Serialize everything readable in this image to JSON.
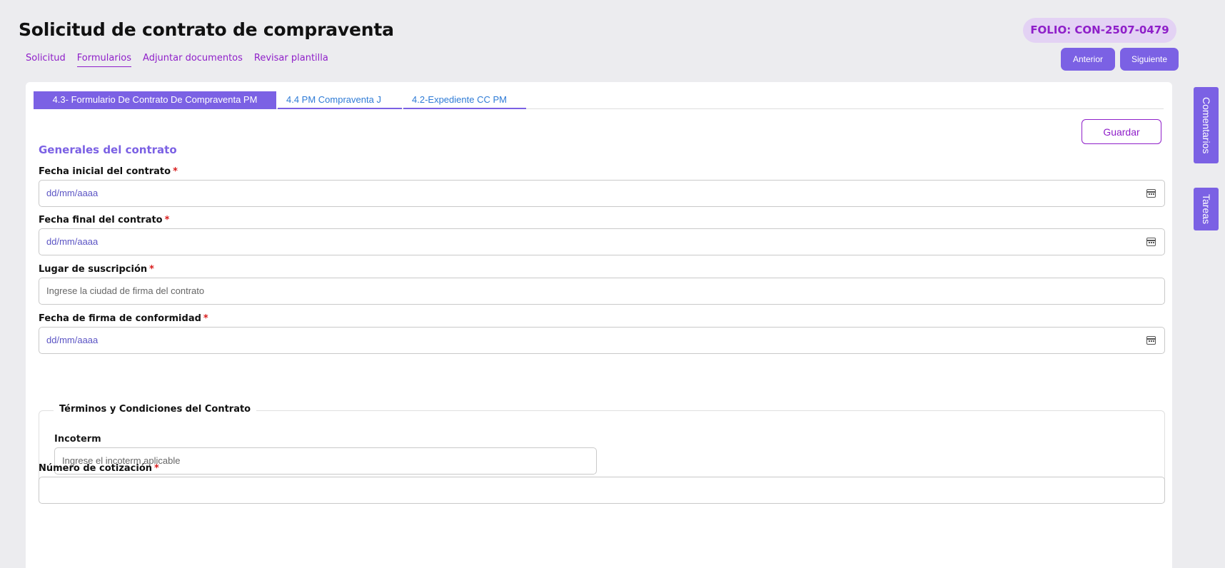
{
  "header": {
    "title": "Solicitud de contrato de compraventa",
    "folio": "FOLIO: CON-2507-0479",
    "prev_label": "Anterior",
    "next_label": "Siguiente"
  },
  "nav": [
    {
      "label": "Solicitud",
      "active": false
    },
    {
      "label": "Formularios",
      "active": true
    },
    {
      "label": "Adjuntar documentos",
      "active": false
    },
    {
      "label": "Revisar plantilla",
      "active": false
    }
  ],
  "tabs": [
    {
      "label": "4.3- Formulario De Contrato De Compraventa PM",
      "active": true
    },
    {
      "label": "4.4 PM Compraventa J",
      "active": false
    },
    {
      "label": "4.2-Expediente CC PM",
      "active": false
    }
  ],
  "form": {
    "save_label": "Guardar",
    "section_title": "Generales del contrato",
    "required_mark": "*",
    "fields": {
      "fecha_inicial": {
        "label": "Fecha inicial del contrato",
        "placeholder": "dd/mm/aaaa"
      },
      "fecha_final": {
        "label": "Fecha final del contrato",
        "placeholder": "dd/mm/aaaa"
      },
      "lugar": {
        "label": "Lugar de suscripción",
        "placeholder": "Ingrese la ciudad de firma del contrato"
      },
      "fecha_firma": {
        "label": "Fecha de firma de conformidad",
        "placeholder": "dd/mm/aaaa"
      },
      "numero_cotizacion": {
        "label": "Número de cotización",
        "placeholder": ""
      }
    },
    "terms": {
      "legend": "Términos y Condiciones del Contrato",
      "incoterm_label": "Incoterm",
      "incoterm_placeholder": "Ingrese el incoterm aplicable"
    }
  },
  "side": {
    "comentarios": "Comentarios",
    "tareas": "Tareas"
  },
  "colors": {
    "accent": "#7b61e4",
    "brand_purple": "#8f1fc9",
    "required": "#d81b1b",
    "background": "#ececef"
  }
}
